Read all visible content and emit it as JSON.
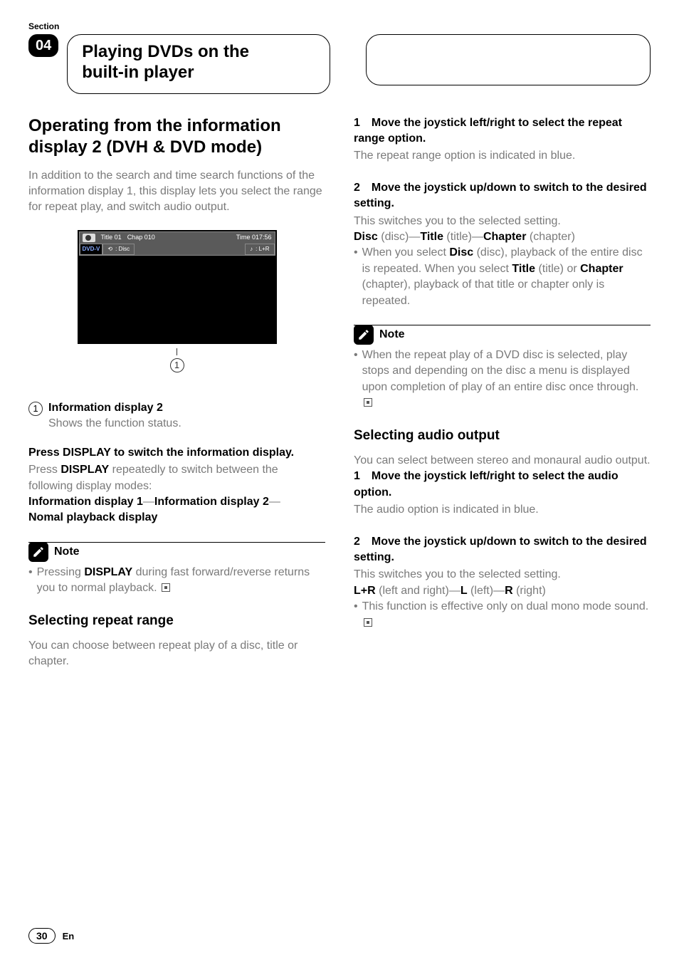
{
  "section_label": "Section",
  "chapter_number": "04",
  "page_title_line1": "Playing DVDs on the",
  "page_title_line2": "built-in player",
  "left": {
    "h2_line1": "Operating from the information",
    "h2_line2": "display 2 (DVH & DVD mode)",
    "intro": "In addition to the search and time search functions of the information display 1, this display lets you select the range for repeat play, and switch audio output.",
    "display": {
      "title": "Title  01",
      "chap": "Chap  010",
      "time": "Time  017:56",
      "dvdv": "DVD-V",
      "repeat_icon": "⟲",
      "repeat_label": ": Disc",
      "audio_icon": "♪",
      "audio_label": ": L+R",
      "callout_num": "1"
    },
    "def_num": "1",
    "def_term": "Information display 2",
    "def_desc": "Shows the function status.",
    "press_heading": "Press DISPLAY to switch the information display.",
    "press_body_pre": "Press ",
    "press_body_bold": "DISPLAY",
    "press_body_post": " repeatedly to switch between the following display modes:",
    "modes_part1": "Information display 1",
    "modes_sep": "—",
    "modes_part2": "Information display 2",
    "modes_part3": "Nomal playback display",
    "note_label": "Note",
    "note_pre": "Pressing ",
    "note_bold": "DISPLAY",
    "note_post": " during fast forward/reverse returns you to normal playback.",
    "repeat_h3": "Selecting repeat range",
    "repeat_intro": "You can choose between repeat play of a disc, title or chapter."
  },
  "right": {
    "step1_heading": "1 Move the joystick left/right to select the repeat range option.",
    "step1_body": "The repeat range option is indicated in blue.",
    "step2_heading": "2 Move the joystick up/down to switch to the desired setting.",
    "step2_body1": "This switches you to the selected setting.",
    "options_disc": "Disc",
    "options_disc_paren": " (disc)—",
    "options_title": "Title",
    "options_title_paren": " (title)—",
    "options_chapter": "Chapter",
    "options_chapter_paren": " (chapter)",
    "bullet_pre": "When you select ",
    "bullet_disc": "Disc",
    "bullet_mid1": " (disc), playback of the entire disc is repeated. When you select ",
    "bullet_title": "Title",
    "bullet_mid2": " (title) or ",
    "bullet_chapter": "Chapter",
    "bullet_post": " (chapter), playback of that title or chapter only is repeated.",
    "note_label": "Note",
    "note_body": "When the repeat play of a DVD disc is selected, play stops and depending on the disc a menu is displayed upon completion of play of an entire disc once through.",
    "audio_h3": "Selecting audio output",
    "audio_intro": "You can select between stereo and monaural audio output.",
    "astep1_heading": "1 Move the joystick left/right to select the audio option.",
    "astep1_body": "The audio option is indicated in blue.",
    "astep2_heading": "2 Move the joystick up/down to switch to the desired setting.",
    "astep2_body": "This switches you to the selected setting.",
    "aopts_lr": "L+R",
    "aopts_lr_paren": " (left and right)—",
    "aopts_l": "L",
    "aopts_l_paren": " (left)—",
    "aopts_r": "R",
    "aopts_r_paren": " (right)",
    "abullet": "This function is effective only on dual mono mode sound."
  },
  "footer": {
    "page": "30",
    "lang": "En"
  }
}
